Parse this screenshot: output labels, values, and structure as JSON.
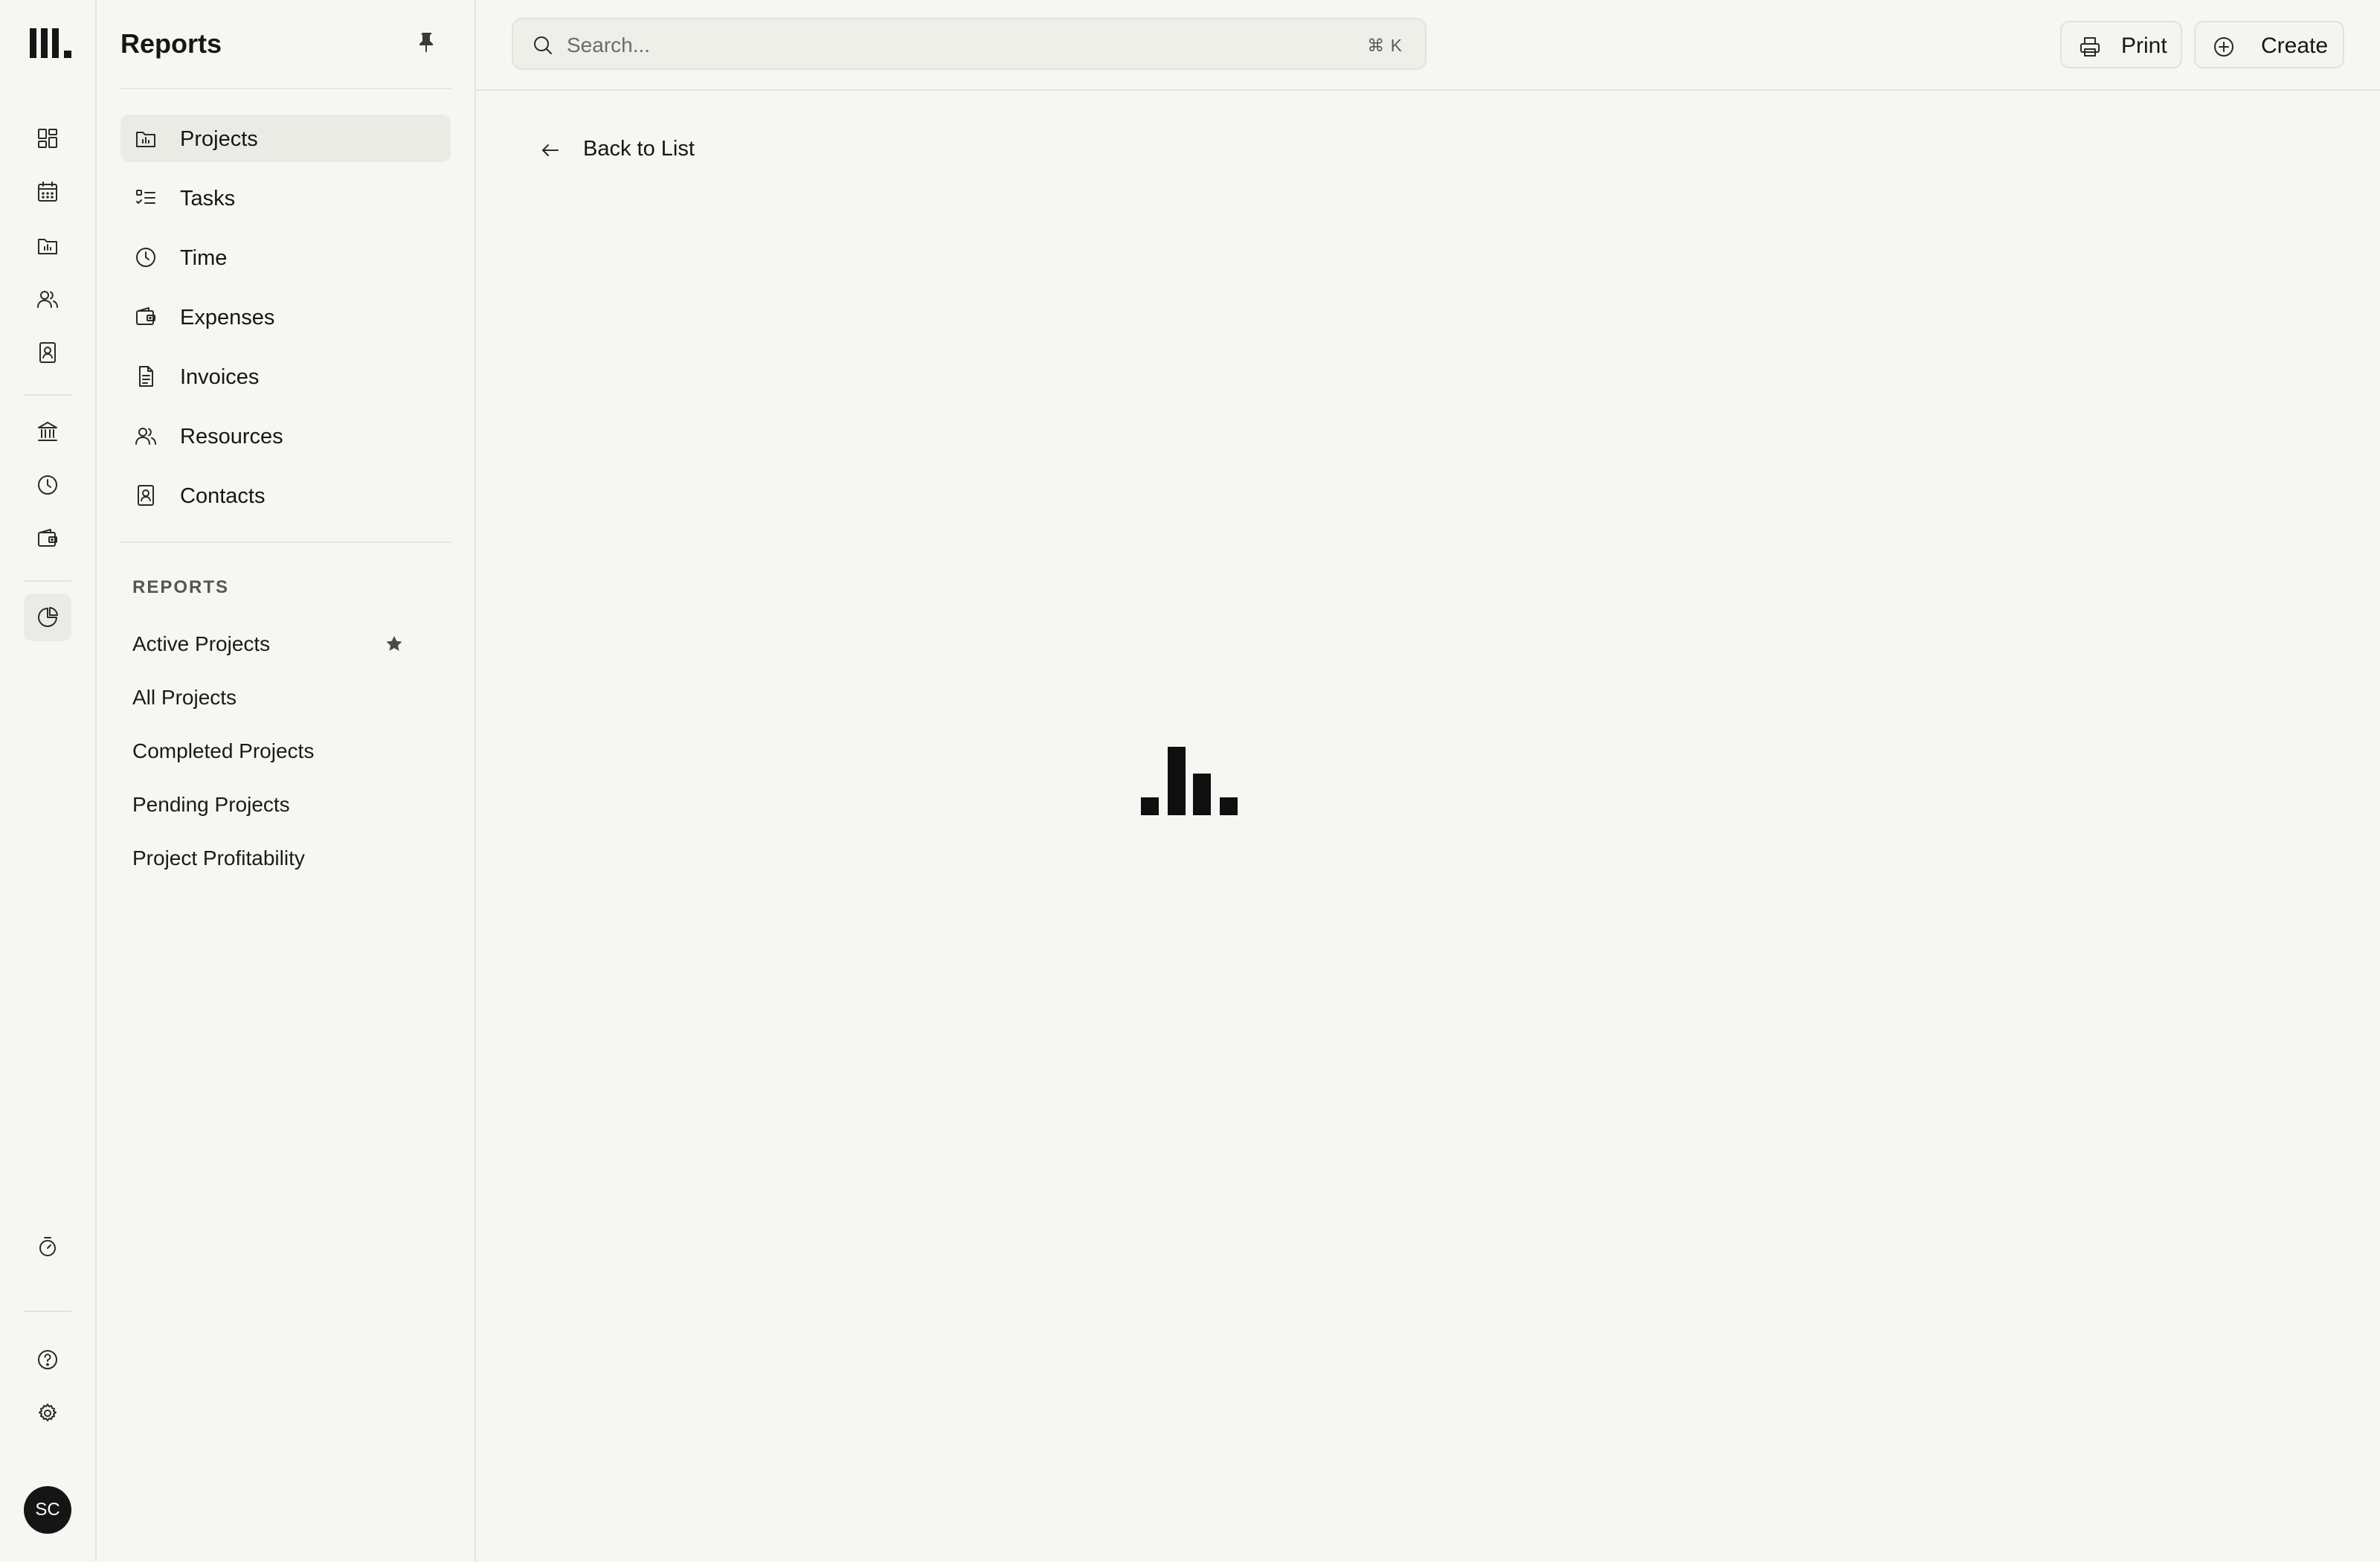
{
  "rail": {
    "avatar_initials": "SC"
  },
  "sidebar": {
    "title": "Reports",
    "items": [
      {
        "label": "Projects",
        "icon": "folder-chart-icon",
        "active": true
      },
      {
        "label": "Tasks",
        "icon": "checklist-icon"
      },
      {
        "label": "Time",
        "icon": "clock-icon"
      },
      {
        "label": "Expenses",
        "icon": "wallet-icon"
      },
      {
        "label": "Invoices",
        "icon": "document-icon"
      },
      {
        "label": "Resources",
        "icon": "users-icon"
      },
      {
        "label": "Contacts",
        "icon": "contact-book-icon"
      }
    ],
    "reports_heading": "REPORTS",
    "reports": [
      {
        "label": "Active Projects",
        "starred": true
      },
      {
        "label": "All Projects"
      },
      {
        "label": "Completed Projects"
      },
      {
        "label": "Pending Projects"
      },
      {
        "label": "Project Profitability"
      }
    ]
  },
  "header": {
    "search_placeholder": "Search...",
    "search_shortcut": "⌘ K",
    "print_label": "Print",
    "create_label": "Create"
  },
  "main": {
    "back_label": "Back to List"
  }
}
